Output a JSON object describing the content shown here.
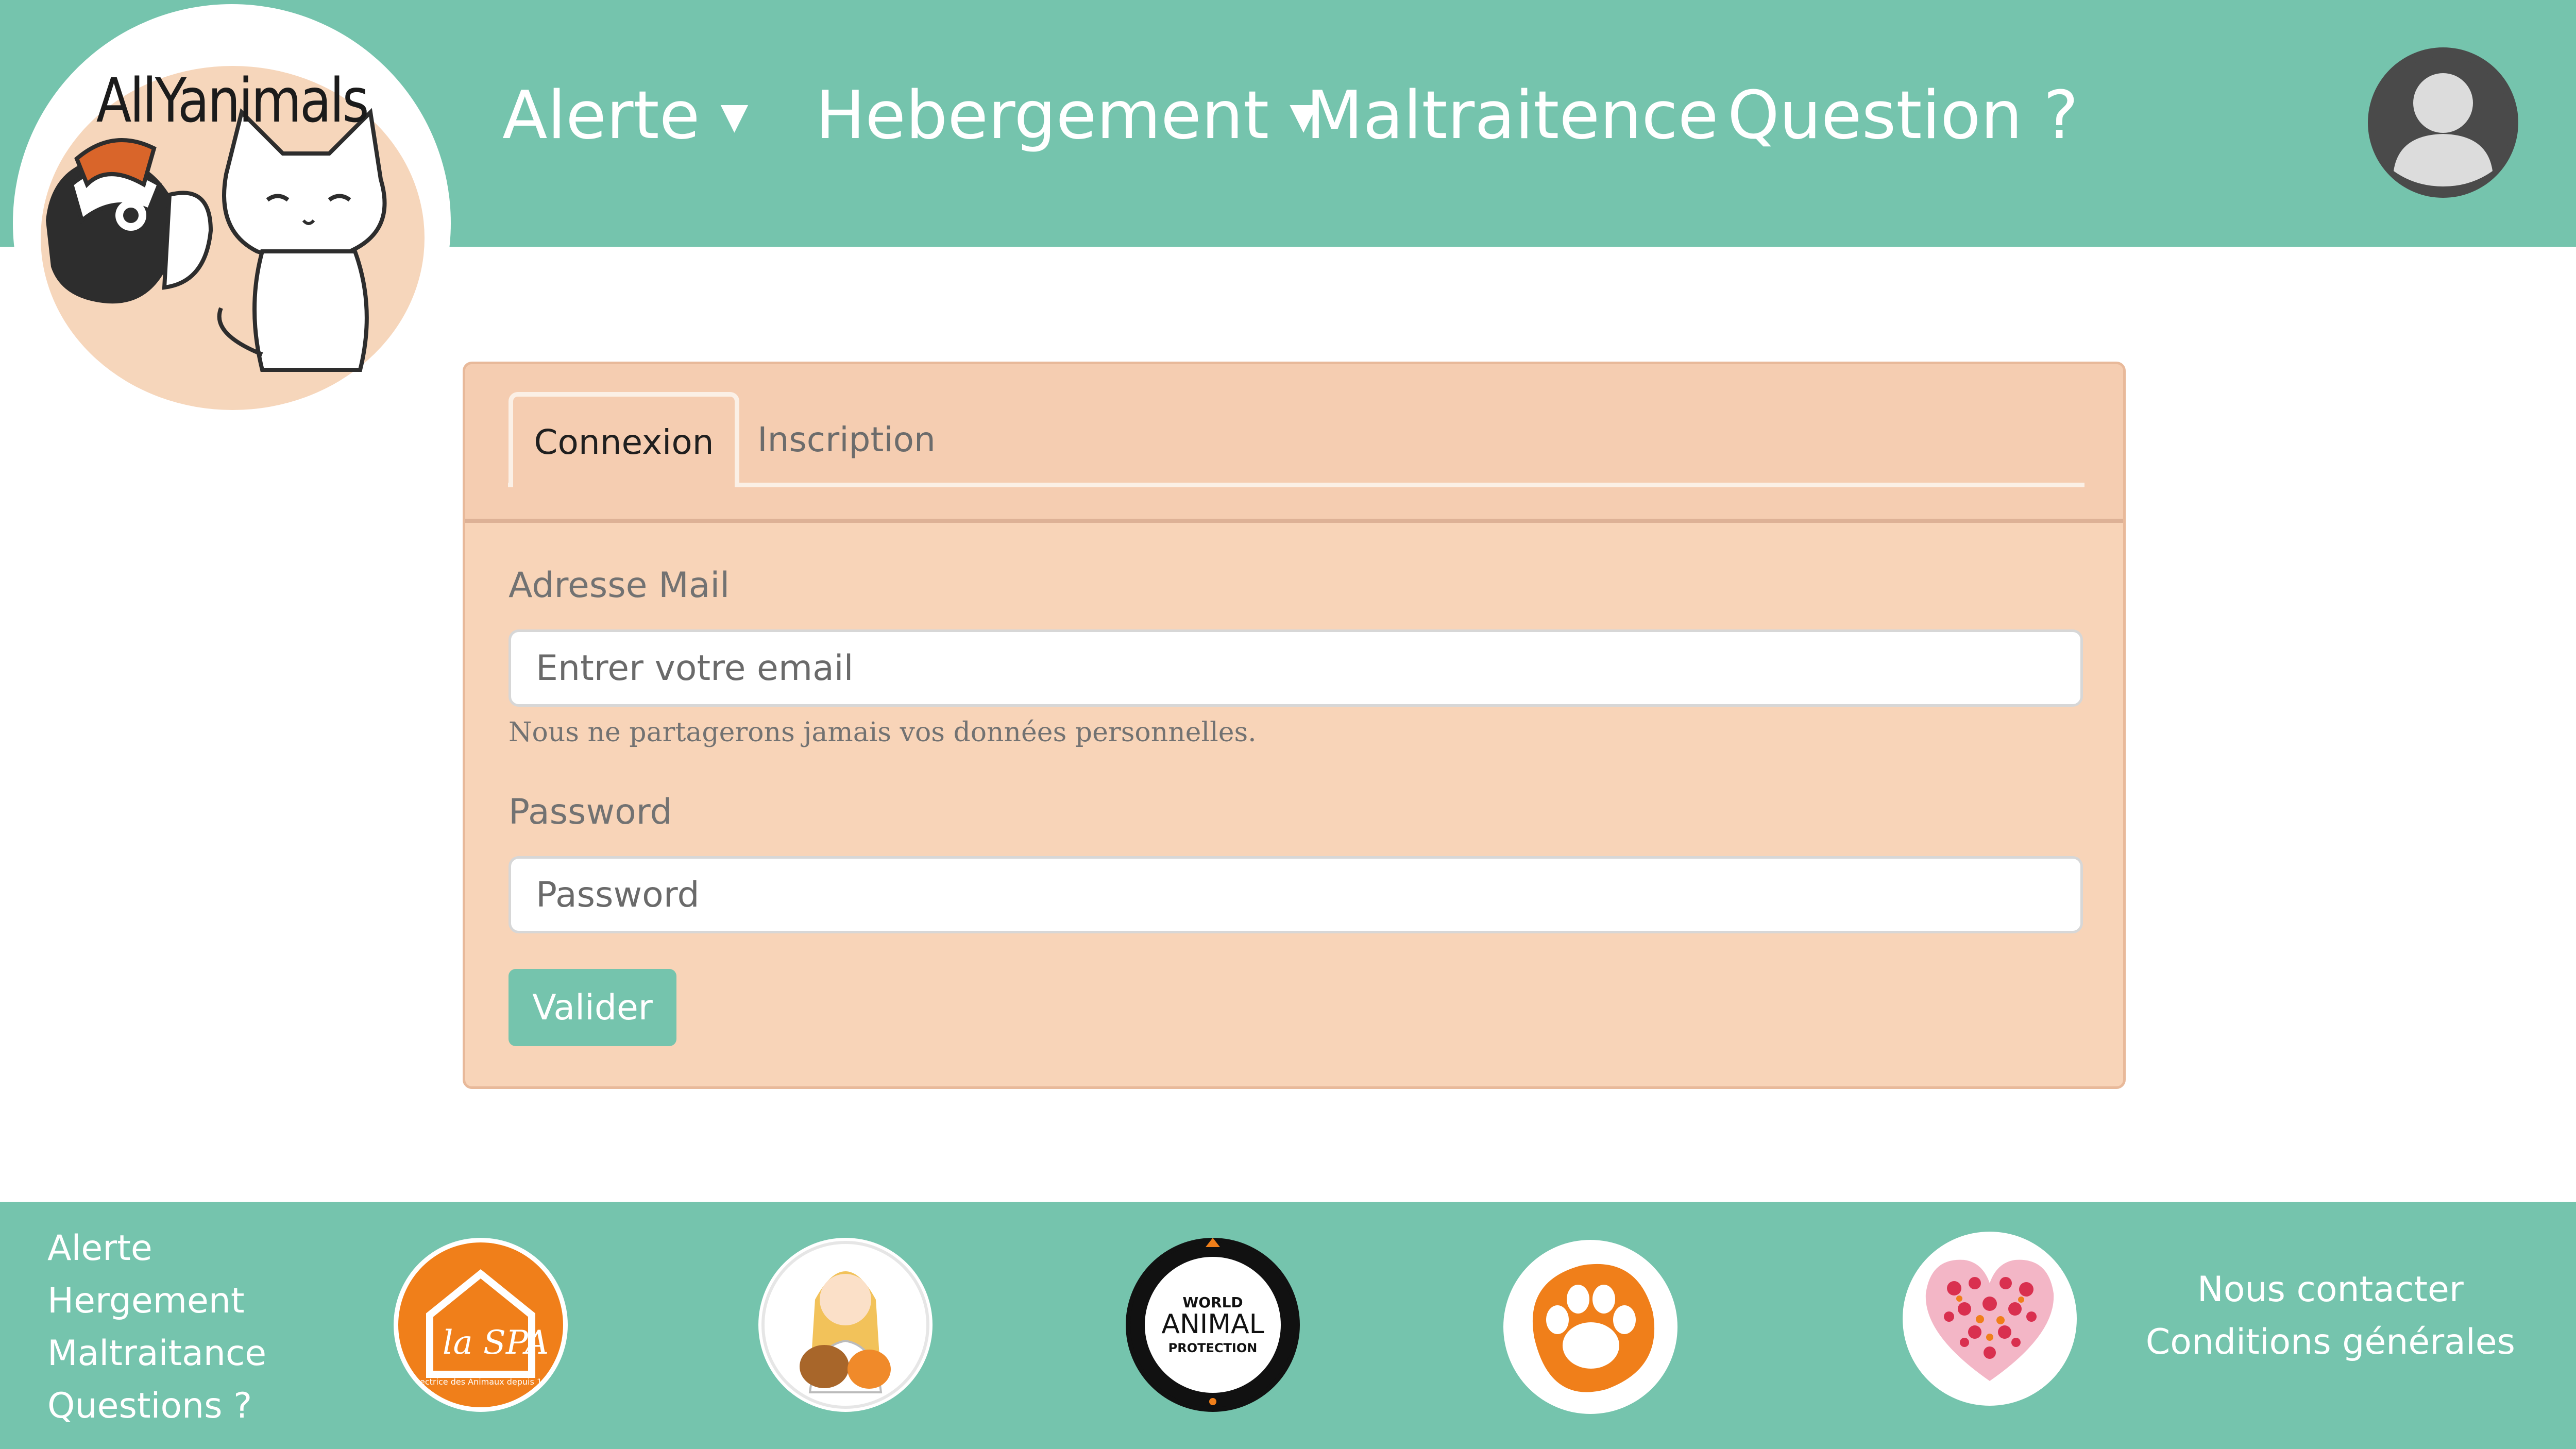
{
  "brand": {
    "logo_text": "AllYanimals"
  },
  "nav": {
    "alerte": "Alerte",
    "hebergement": "Hebergement",
    "maltraitence": "Maltraitence",
    "question": "Question ?",
    "caret": "▼"
  },
  "login": {
    "tab_connexion": "Connexion",
    "tab_inscription": "Inscription",
    "email_label": "Adresse Mail",
    "email_placeholder": "Entrer votre email",
    "email_help": "Nous ne partagerons jamais vos données personnelles.",
    "password_label": "Password",
    "password_placeholder": "Password",
    "submit": "Valider"
  },
  "footer": {
    "links": [
      "Alerte",
      "Hergement",
      "Maltraitance",
      "Questions ?"
    ],
    "contact": "Nous contacter",
    "terms": "Conditions générales",
    "partners": {
      "spa": {
        "title": "la SPA",
        "subtitle": "Protectrice des Animaux depuis 1845"
      },
      "wap": {
        "line1": "WORLD",
        "line2": "ANIMAL",
        "line3": "PROTECTION"
      }
    }
  },
  "colors": {
    "primary": "#75c4ad",
    "card": "#f8d4b8",
    "card_header": "#f5cdb1",
    "orange": "#f07f1a"
  }
}
